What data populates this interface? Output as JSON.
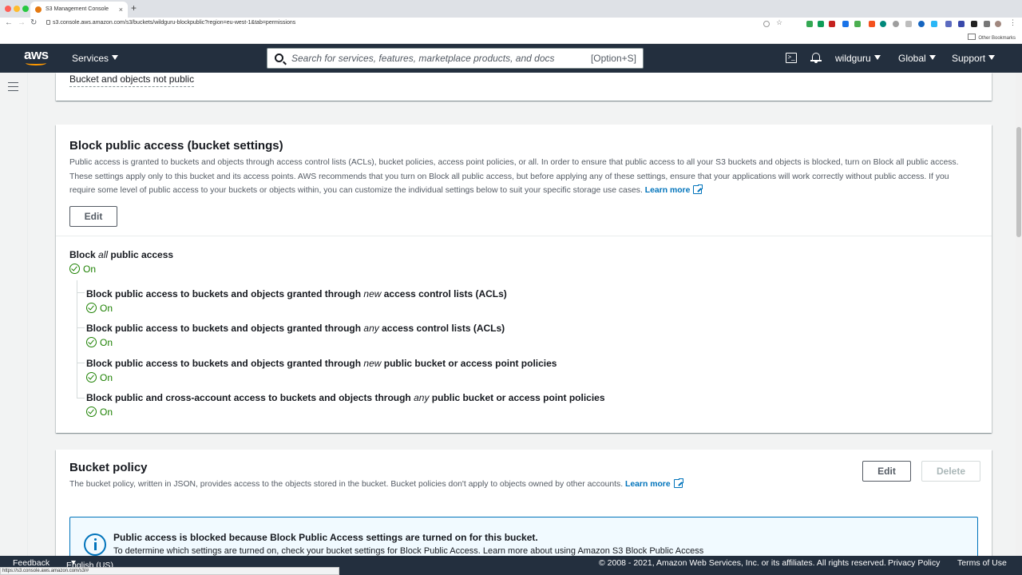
{
  "browser": {
    "tab_title": "S3 Management Console",
    "tab_close": "×",
    "new_tab": "+",
    "url": "s3.console.aws.amazon.com/s3/buckets/wildguru-blockpublic?region=eu-west-1&tab=permissions",
    "other_bookmarks": "Other Bookmarks",
    "status_url": "https://s3.console.aws.amazon.com/s3/#",
    "back": "←",
    "forward": "→",
    "reload": "↻"
  },
  "awsnav": {
    "logo_text": "aws",
    "services_label": "Services",
    "search_placeholder": "Search for services, features, marketplace products, and docs",
    "search_shortcut": "[Option+S]",
    "cloudshell_glyph": ">_",
    "account_label": "wildguru",
    "region_label": "Global",
    "support_label": "Support"
  },
  "access_summary": {
    "text": "Bucket and objects not public"
  },
  "block_public_access": {
    "title": "Block public access (bucket settings)",
    "description": "Public access is granted to buckets and objects through access control lists (ACLs), bucket policies, access point policies, or all. In order to ensure that public access to all your S3 buckets and objects is blocked, turn on Block all public access. These settings apply only to this bucket and its access points. AWS recommends that you turn on Block all public access, but before applying any of these settings, ensure that your applications will work correctly without public access. If you require some level of public access to your buckets or objects within, you can customize the individual settings below to suit your specific storage use cases.",
    "learn_more": "Learn more",
    "edit_label": "Edit",
    "block_all": {
      "prefix": "Block ",
      "emphasis": "all",
      "suffix": " public access",
      "status": "On"
    },
    "settings": [
      {
        "prefix": "Block public access to buckets and objects granted through ",
        "emphasis": "new",
        "suffix": " access control lists (ACLs)",
        "status": "On"
      },
      {
        "prefix": "Block public access to buckets and objects granted through ",
        "emphasis": "any",
        "suffix": " access control lists (ACLs)",
        "status": "On"
      },
      {
        "prefix": "Block public access to buckets and objects granted through ",
        "emphasis": "new",
        "suffix": " public bucket or access point policies",
        "status": "On"
      },
      {
        "prefix": "Block public and cross-account access to buckets and objects through ",
        "emphasis": "any",
        "suffix": " public bucket or access point policies",
        "status": "On"
      }
    ]
  },
  "bucket_policy": {
    "title": "Bucket policy",
    "description": "The bucket policy, written in JSON, provides access to the objects stored in the bucket. Bucket policies don't apply to objects owned by other accounts.",
    "learn_more": "Learn more",
    "edit_label": "Edit",
    "delete_label": "Delete",
    "alert_title": "Public access is blocked because Block Public Access settings are turned on for this bucket.",
    "alert_body": "To determine which settings are turned on, check your bucket settings for Block Public Access. Learn more about using Amazon S3 Block Public Access"
  },
  "footer": {
    "feedback": "Feedback",
    "language": "English (US)",
    "copyright": "© 2008 - 2021, Amazon Web Services, Inc. or its affiliates. All rights reserved.",
    "privacy": "Privacy Policy",
    "terms": "Terms of Use"
  },
  "colors": {
    "nav_bg": "#232f3e",
    "link": "#0073bb",
    "success": "#1d8102",
    "aws_orange": "#ff9900"
  }
}
